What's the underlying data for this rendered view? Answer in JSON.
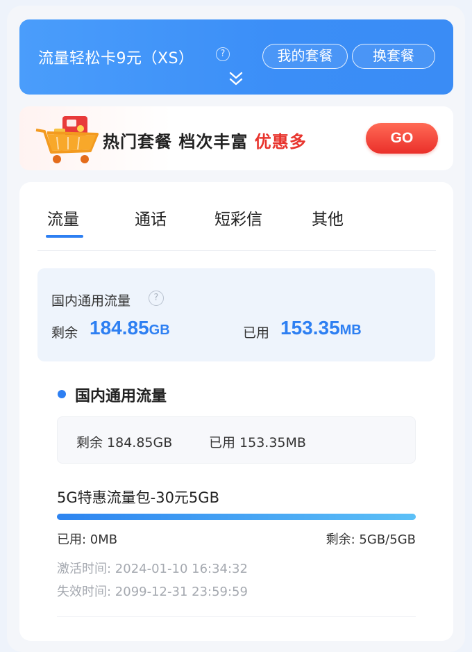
{
  "plan": {
    "title": "流量轻松卡9元（XS）",
    "help": "?",
    "my_plan_label": "我的套餐",
    "change_plan_label": "换套餐",
    "accent_color": "#3b8ef7"
  },
  "promo": {
    "text_main": "热门套餐 档次丰富 ",
    "text_highlight": "优惠多",
    "go_label": "GO",
    "highlight_color": "#e8342d"
  },
  "tabs": [
    {
      "label": "流量",
      "active": true
    },
    {
      "label": "通话",
      "active": false
    },
    {
      "label": "短彩信",
      "active": false
    },
    {
      "label": "其他",
      "active": false
    }
  ],
  "summary": {
    "title": "国内通用流量",
    "help": "?",
    "remaining_label": "剩余",
    "remaining_value": "184.85",
    "remaining_unit": "GB",
    "used_label": "已用",
    "used_value": "153.35",
    "used_unit": "MB"
  },
  "section": {
    "title": "国内通用流量",
    "remaining_text": "剩余 184.85GB",
    "used_text": "已用 153.35MB"
  },
  "package": {
    "name": "5G特惠流量包-30元5GB",
    "remaining_fraction": 1.0,
    "used_text": "已用: 0MB",
    "remaining_text": "剩余: 5GB/5GB",
    "activated_text": "激活时间: 2024-01-10 16:34:32",
    "expires_text": "失效时间: 2099-12-31 23:59:59"
  }
}
